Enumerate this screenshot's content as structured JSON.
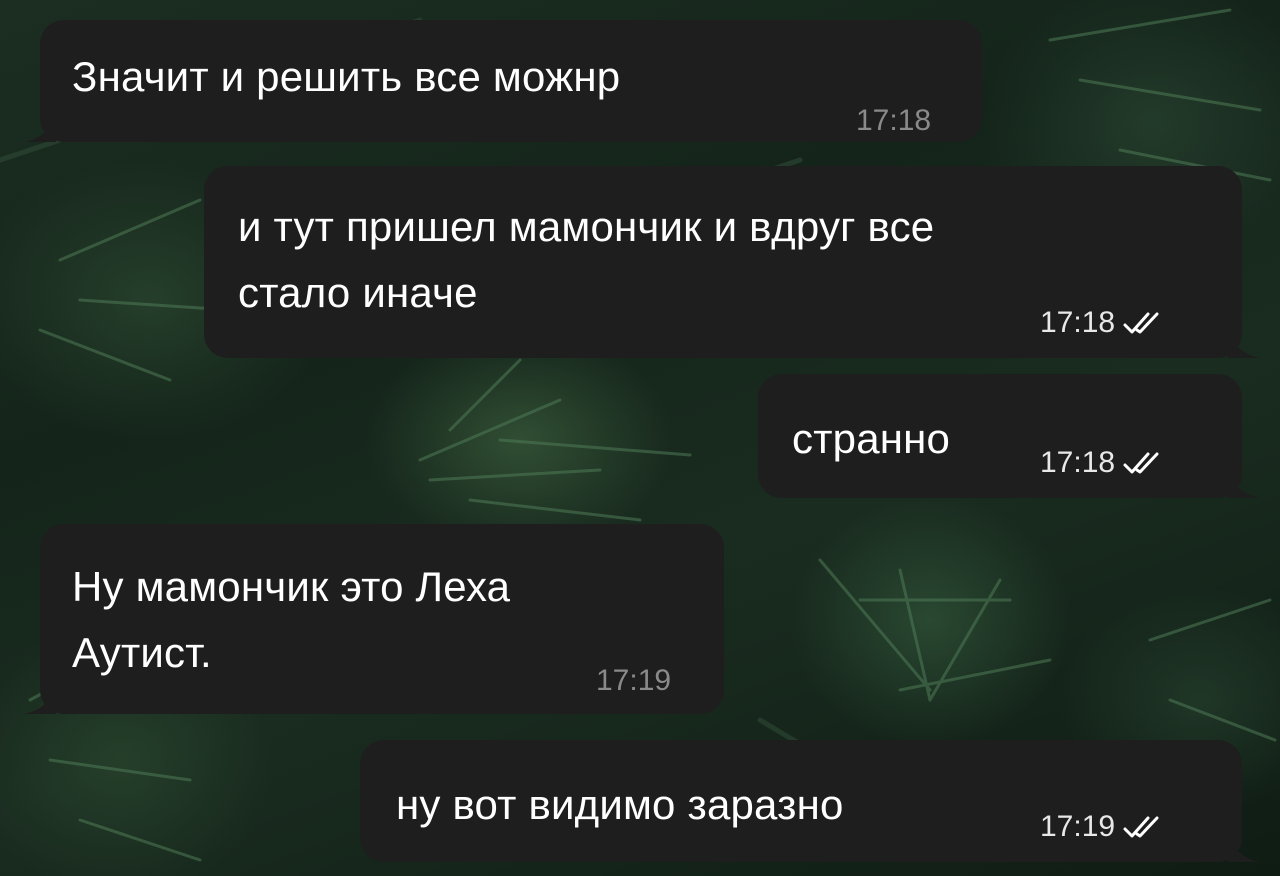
{
  "colors": {
    "bubble": "#1e1e1e",
    "text": "#ffffff",
    "incoming_time": "#8a8a8a",
    "outgoing_time": "#e8e8e8"
  },
  "messages": [
    {
      "direction": "incoming",
      "lines": [
        "Значит и решить все можнр"
      ],
      "time": "17:18"
    },
    {
      "direction": "outgoing",
      "lines": [
        "и тут пришел мамончик и вдруг все",
        "стало иначе"
      ],
      "time": "17:18",
      "status_icon": "double-check-icon"
    },
    {
      "direction": "outgoing",
      "lines": [
        "странно"
      ],
      "time": "17:18",
      "status_icon": "double-check-icon"
    },
    {
      "direction": "incoming",
      "lines": [
        "Ну мамончик это Леха",
        "Аутист."
      ],
      "time": "17:19"
    },
    {
      "direction": "outgoing",
      "lines": [
        "ну вот видимо заразно"
      ],
      "time": "17:19",
      "status_icon": "double-check-icon"
    }
  ]
}
